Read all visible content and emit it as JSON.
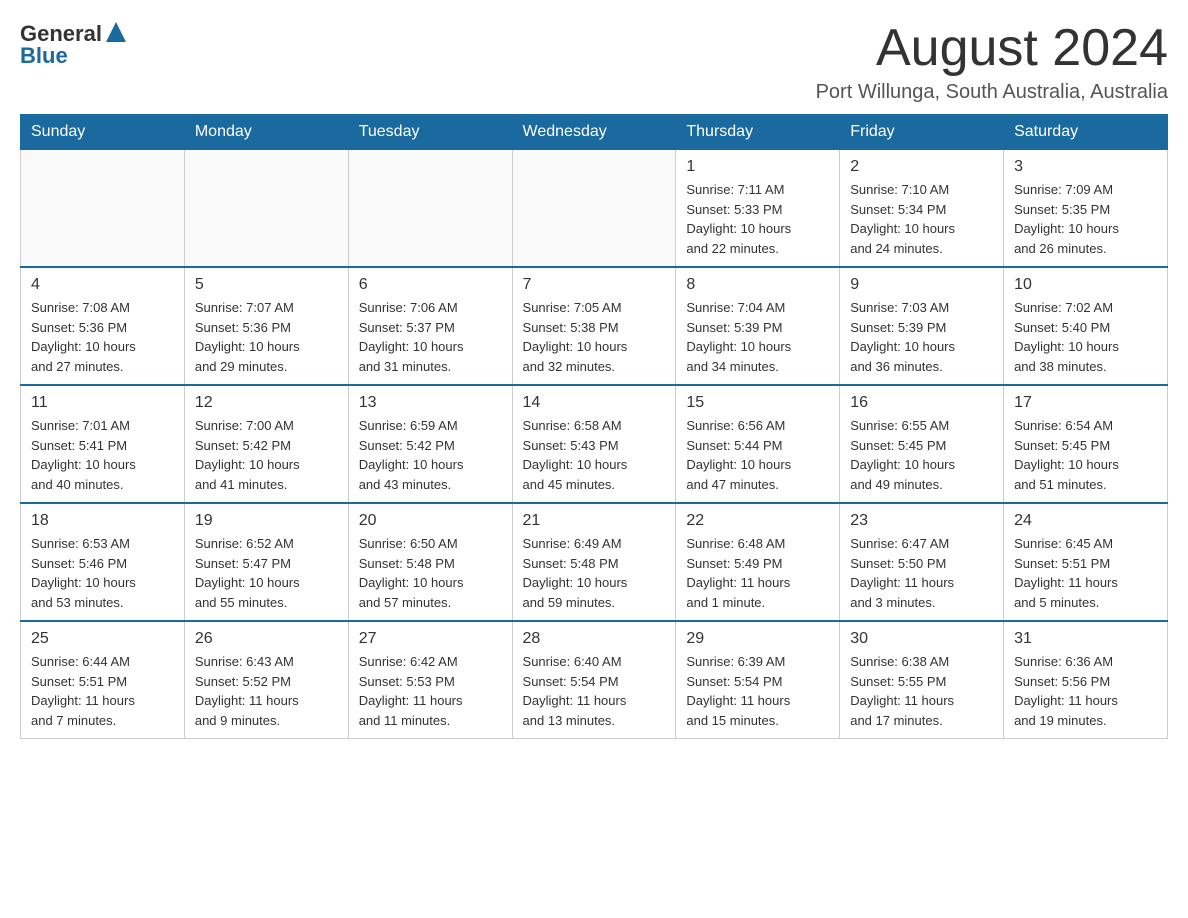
{
  "header": {
    "logo": {
      "general": "General",
      "triangle": "▲",
      "blue": "Blue"
    },
    "title": "August 2024",
    "location": "Port Willunga, South Australia, Australia"
  },
  "days_of_week": [
    "Sunday",
    "Monday",
    "Tuesday",
    "Wednesday",
    "Thursday",
    "Friday",
    "Saturday"
  ],
  "weeks": [
    [
      {
        "day": "",
        "info": ""
      },
      {
        "day": "",
        "info": ""
      },
      {
        "day": "",
        "info": ""
      },
      {
        "day": "",
        "info": ""
      },
      {
        "day": "1",
        "info": "Sunrise: 7:11 AM\nSunset: 5:33 PM\nDaylight: 10 hours\nand 22 minutes."
      },
      {
        "day": "2",
        "info": "Sunrise: 7:10 AM\nSunset: 5:34 PM\nDaylight: 10 hours\nand 24 minutes."
      },
      {
        "day": "3",
        "info": "Sunrise: 7:09 AM\nSunset: 5:35 PM\nDaylight: 10 hours\nand 26 minutes."
      }
    ],
    [
      {
        "day": "4",
        "info": "Sunrise: 7:08 AM\nSunset: 5:36 PM\nDaylight: 10 hours\nand 27 minutes."
      },
      {
        "day": "5",
        "info": "Sunrise: 7:07 AM\nSunset: 5:36 PM\nDaylight: 10 hours\nand 29 minutes."
      },
      {
        "day": "6",
        "info": "Sunrise: 7:06 AM\nSunset: 5:37 PM\nDaylight: 10 hours\nand 31 minutes."
      },
      {
        "day": "7",
        "info": "Sunrise: 7:05 AM\nSunset: 5:38 PM\nDaylight: 10 hours\nand 32 minutes."
      },
      {
        "day": "8",
        "info": "Sunrise: 7:04 AM\nSunset: 5:39 PM\nDaylight: 10 hours\nand 34 minutes."
      },
      {
        "day": "9",
        "info": "Sunrise: 7:03 AM\nSunset: 5:39 PM\nDaylight: 10 hours\nand 36 minutes."
      },
      {
        "day": "10",
        "info": "Sunrise: 7:02 AM\nSunset: 5:40 PM\nDaylight: 10 hours\nand 38 minutes."
      }
    ],
    [
      {
        "day": "11",
        "info": "Sunrise: 7:01 AM\nSunset: 5:41 PM\nDaylight: 10 hours\nand 40 minutes."
      },
      {
        "day": "12",
        "info": "Sunrise: 7:00 AM\nSunset: 5:42 PM\nDaylight: 10 hours\nand 41 minutes."
      },
      {
        "day": "13",
        "info": "Sunrise: 6:59 AM\nSunset: 5:42 PM\nDaylight: 10 hours\nand 43 minutes."
      },
      {
        "day": "14",
        "info": "Sunrise: 6:58 AM\nSunset: 5:43 PM\nDaylight: 10 hours\nand 45 minutes."
      },
      {
        "day": "15",
        "info": "Sunrise: 6:56 AM\nSunset: 5:44 PM\nDaylight: 10 hours\nand 47 minutes."
      },
      {
        "day": "16",
        "info": "Sunrise: 6:55 AM\nSunset: 5:45 PM\nDaylight: 10 hours\nand 49 minutes."
      },
      {
        "day": "17",
        "info": "Sunrise: 6:54 AM\nSunset: 5:45 PM\nDaylight: 10 hours\nand 51 minutes."
      }
    ],
    [
      {
        "day": "18",
        "info": "Sunrise: 6:53 AM\nSunset: 5:46 PM\nDaylight: 10 hours\nand 53 minutes."
      },
      {
        "day": "19",
        "info": "Sunrise: 6:52 AM\nSunset: 5:47 PM\nDaylight: 10 hours\nand 55 minutes."
      },
      {
        "day": "20",
        "info": "Sunrise: 6:50 AM\nSunset: 5:48 PM\nDaylight: 10 hours\nand 57 minutes."
      },
      {
        "day": "21",
        "info": "Sunrise: 6:49 AM\nSunset: 5:48 PM\nDaylight: 10 hours\nand 59 minutes."
      },
      {
        "day": "22",
        "info": "Sunrise: 6:48 AM\nSunset: 5:49 PM\nDaylight: 11 hours\nand 1 minute."
      },
      {
        "day": "23",
        "info": "Sunrise: 6:47 AM\nSunset: 5:50 PM\nDaylight: 11 hours\nand 3 minutes."
      },
      {
        "day": "24",
        "info": "Sunrise: 6:45 AM\nSunset: 5:51 PM\nDaylight: 11 hours\nand 5 minutes."
      }
    ],
    [
      {
        "day": "25",
        "info": "Sunrise: 6:44 AM\nSunset: 5:51 PM\nDaylight: 11 hours\nand 7 minutes."
      },
      {
        "day": "26",
        "info": "Sunrise: 6:43 AM\nSunset: 5:52 PM\nDaylight: 11 hours\nand 9 minutes."
      },
      {
        "day": "27",
        "info": "Sunrise: 6:42 AM\nSunset: 5:53 PM\nDaylight: 11 hours\nand 11 minutes."
      },
      {
        "day": "28",
        "info": "Sunrise: 6:40 AM\nSunset: 5:54 PM\nDaylight: 11 hours\nand 13 minutes."
      },
      {
        "day": "29",
        "info": "Sunrise: 6:39 AM\nSunset: 5:54 PM\nDaylight: 11 hours\nand 15 minutes."
      },
      {
        "day": "30",
        "info": "Sunrise: 6:38 AM\nSunset: 5:55 PM\nDaylight: 11 hours\nand 17 minutes."
      },
      {
        "day": "31",
        "info": "Sunrise: 6:36 AM\nSunset: 5:56 PM\nDaylight: 11 hours\nand 19 minutes."
      }
    ]
  ]
}
